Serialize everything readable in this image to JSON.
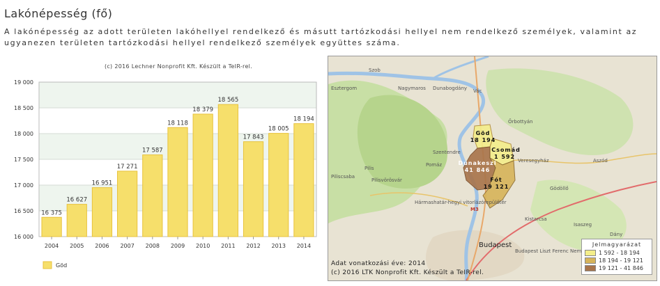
{
  "page": {
    "title": "Lakónépesség (fő)",
    "description": "A lakónépesség az adott területen lakóhellyel rendelkező és másutt tartózkodási hellyel nem rendelkező személyek, valamint az ugyanezen területen tartózkodási hellyel rendelkező személyek együttes száma."
  },
  "chart_data": {
    "type": "bar",
    "title": "(c) 2016 Lechner Nonprofit Kft. Készült a TeIR-rel.",
    "categories": [
      "2004",
      "2005",
      "2006",
      "2007",
      "2008",
      "2009",
      "2010",
      "2011",
      "2012",
      "2013",
      "2014"
    ],
    "series": [
      {
        "name": "Göd",
        "values": [
          16375,
          16627,
          16951,
          17271,
          17587,
          18118,
          18379,
          18565,
          17843,
          18005,
          18194
        ]
      }
    ],
    "value_labels": [
      "16 375",
      "16 627",
      "16 951",
      "17 271",
      "17 587",
      "18 118",
      "18 379",
      "18 565",
      "17 843",
      "18 005",
      "18 194"
    ],
    "yticks": [
      16000,
      16500,
      17000,
      17500,
      18000,
      18500,
      19000
    ],
    "ytick_labels": [
      "16 000",
      "16 500",
      "17 000",
      "17 500",
      "18 000",
      "18 500",
      "19 000"
    ],
    "ylim": [
      16000,
      19000
    ],
    "legend_position": "bottom-left",
    "bar_color": "#f6df6b",
    "bar_stroke": "#e8c23c"
  },
  "map": {
    "places": [
      "Szob",
      "Nagymaros",
      "Dunabogdány",
      "Vác",
      "Esztergom",
      "Szentendre",
      "Őrbottyán",
      "Veresegyház",
      "Pomáz",
      "Pilisvörösvár",
      "Pilis",
      "Piliscsaba",
      "Gödöllő",
      "Aszód",
      "Kistarcsa",
      "Budapest",
      "Budapest Liszt Ferenc Nemzetközi Repülőtér",
      "Hármashatár-hegyi vitorlázórepülőtér",
      "Isaszeg",
      "Dány",
      "M3"
    ],
    "regions": [
      {
        "name": "Göd",
        "value": "18 194"
      },
      {
        "name": "Csomád",
        "value": "1 592"
      },
      {
        "name": "Dunakeszi",
        "value": "41 846"
      },
      {
        "name": "Fót",
        "value": "19 121"
      }
    ],
    "legend": {
      "title": "Jelmagyarázat",
      "items": [
        {
          "label": "1 592 - 18 194",
          "color": "#f4ee8a"
        },
        {
          "label": "18 194 - 19 121",
          "color": "#d7b45a"
        },
        {
          "label": "19 121 - 41 846",
          "color": "#a8744a"
        }
      ]
    },
    "footer_year": "Adat vonatkozási éve: 2014",
    "footer_copyright": "(c) 2016 LTK Nonprofit Kft. Készült a TeIR-rel."
  }
}
